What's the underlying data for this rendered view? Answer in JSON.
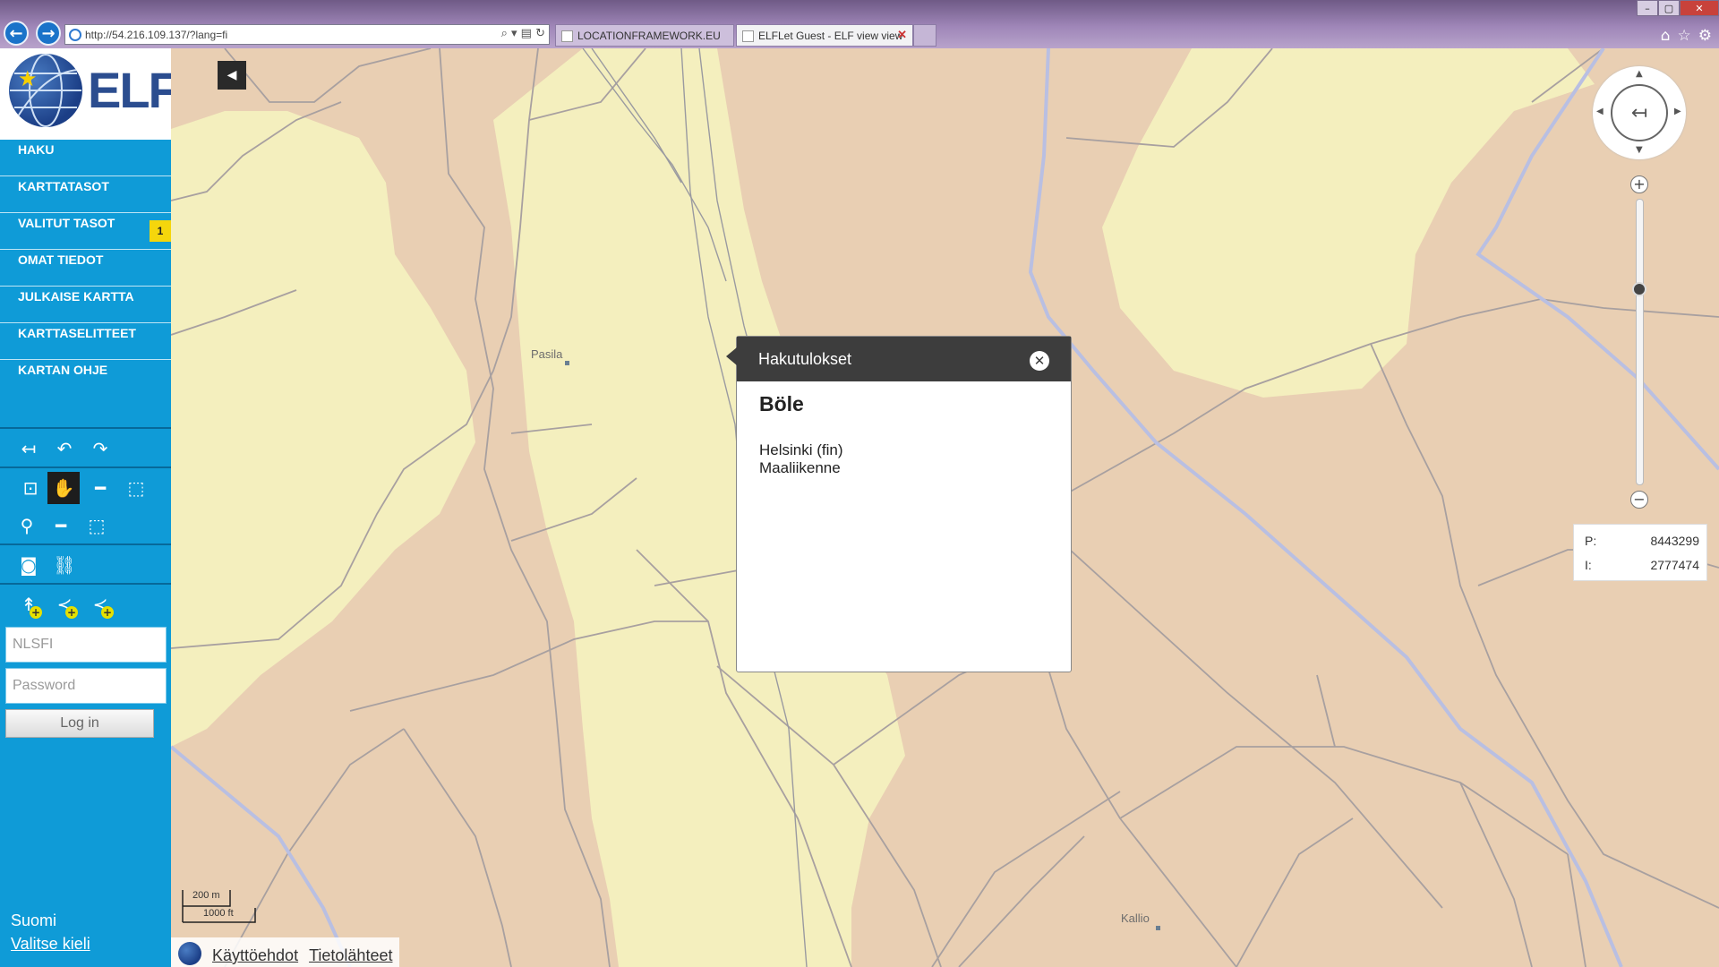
{
  "browser": {
    "url": "http://54.216.109.137/?lang=fi",
    "tabs": [
      {
        "label": "LOCATIONFRAMEWORK.EU"
      },
      {
        "label": "ELFLet Guest - ELF view view"
      }
    ],
    "tab_close": "✕",
    "nav_back": "←",
    "nav_forward": "→",
    "win_buttons": [
      "–",
      "▢",
      "✕"
    ],
    "right_icons": [
      "⌂",
      "☆",
      "⚙"
    ],
    "address_tools": "⌕ ▾ ▤ ↻"
  },
  "sidebar": {
    "logo_text": "ELF",
    "logo_star": "★",
    "menu": [
      {
        "label": "HAKU"
      },
      {
        "label": "KARTTATASOT"
      },
      {
        "label": "VALITUT TASOT",
        "badge": "1"
      },
      {
        "label": "OMAT TIEDOT"
      },
      {
        "label": "JULKAISE KARTTA"
      },
      {
        "label": "KARTTASELITTEET"
      },
      {
        "label": "KARTAN OHJE"
      }
    ],
    "tools": {
      "reset_icon": "↤",
      "undo_icon": "↶",
      "redo_icon": "↷",
      "zoom_box_icon": "⊡",
      "pan_icon": "✋",
      "measure_line_icon": "━",
      "measure_area_icon": "⬚",
      "marker_icon": "⚲",
      "line_icon": "━",
      "area_icon": "⬚",
      "camera_icon": "◙",
      "link_icon": "⛓",
      "add_point_icon": "↟",
      "add_line_icon": "≺",
      "add_area_icon": "≺",
      "plus": "+"
    },
    "login": {
      "user_placeholder": "NLSFI",
      "password_placeholder": "Password",
      "button": "Log in"
    },
    "language": {
      "current": "Suomi",
      "change": "Valitse kieli"
    }
  },
  "map": {
    "collapse_icon": "◀",
    "places": [
      {
        "name": "Pasila"
      },
      {
        "name": "Kallio"
      }
    ],
    "popup": {
      "header": "Hakutulokset",
      "close_icon": "✕",
      "title": "Böle",
      "lines": [
        "Helsinki (fin)",
        "Maaliikenne"
      ]
    },
    "pan_center_icon": "↤",
    "pan_arrows": {
      "up": "▲",
      "down": "▼",
      "left": "◀",
      "right": "▶"
    },
    "zoom_in": "+",
    "zoom_out": "−",
    "zoom_level_fraction": 0.3,
    "coordinates": {
      "p_label": "P:",
      "p_value": "8443299",
      "i_label": "I:",
      "i_value": "2777474"
    },
    "scale": {
      "top": "200 m",
      "bottom": "1000 ft"
    },
    "footer": {
      "terms": "Käyttöehdot",
      "sources": "Tietolähteet"
    },
    "colors": {
      "land": "#e9cfb3",
      "green": "#f4efbe",
      "road": "#a8a0a0",
      "water_line": "#b9bfe2"
    }
  }
}
